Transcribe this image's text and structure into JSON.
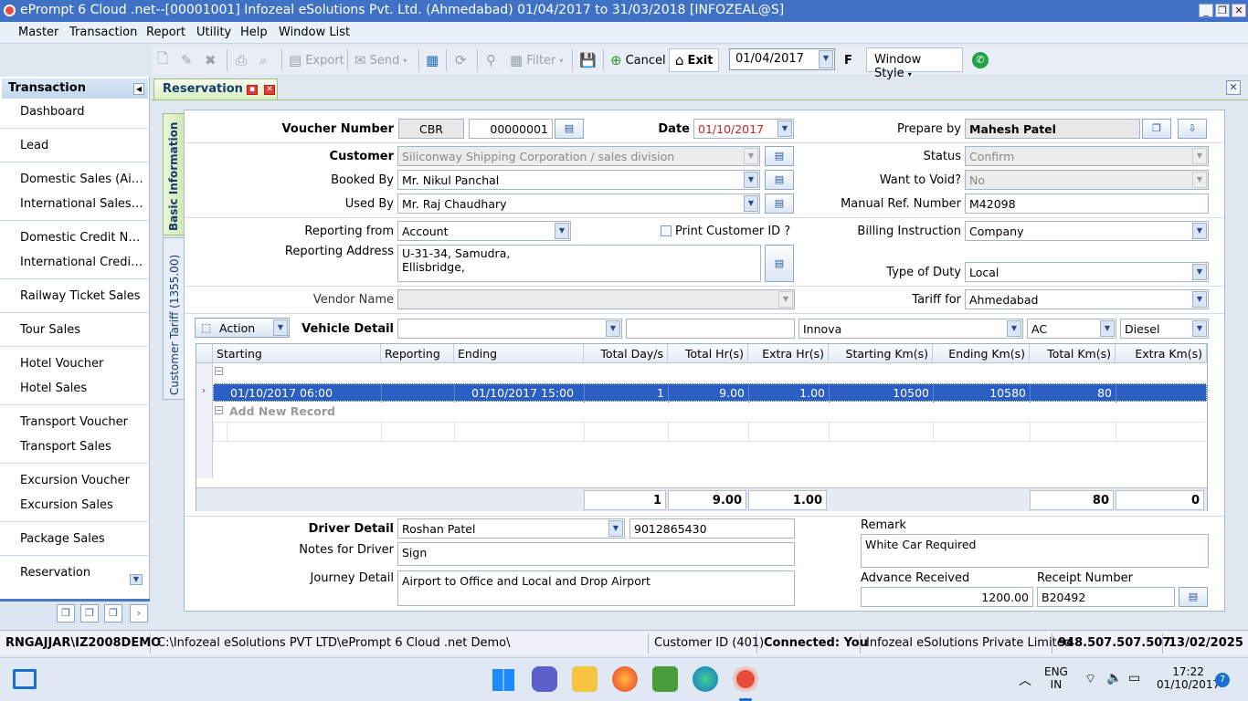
{
  "window": {
    "title": "ePrompt 6 Cloud .net--[00001001] Infozeal eSolutions Pvt. Ltd. (Ahmedabad) 01/04/2017 to 31/03/2018 [INFOZEAL@S]"
  },
  "menu": [
    "Master",
    "Transaction",
    "Report",
    "Utility",
    "Help",
    "Window List"
  ],
  "toolbar": {
    "export": "Export",
    "send": "Send",
    "filter": "Filter",
    "cancel": "Cancel",
    "exit": "Exit",
    "date": "01/04/2017",
    "f": "F",
    "window_style": "Window Style"
  },
  "sidebar": {
    "header": "Transaction",
    "items": [
      "Dashboard",
      "Lead",
      "Domestic Sales (Air ...",
      "International Sales (...",
      "Domestic Credit Note...",
      "International Credit N...",
      "Railway Ticket Sales",
      "Tour Sales",
      "Hotel Voucher",
      "Hotel Sales",
      "Transport Voucher",
      "Transport Sales",
      "Excursion Voucher",
      "Excursion Sales",
      "Package Sales",
      "Reservation"
    ]
  },
  "tab": {
    "label": "Reservation"
  },
  "vtabs": {
    "basic": "Basic Information",
    "tariff": "Customer Tariff (1355.00)"
  },
  "form": {
    "voucher_label": "Voucher Number",
    "voucher_prefix": "CBR",
    "voucher_no": "00000001",
    "date_label": "Date",
    "date": "01/10/2017",
    "prepare_label": "Prepare by",
    "prepare_by": "Mahesh Patel",
    "customer_label": "Customer",
    "customer": "Siliconway Shipping Corporation / sales division",
    "status_label": "Status",
    "status": "Confirm",
    "booked_label": "Booked By",
    "booked_by": "Mr. Nikul Panchal",
    "void_label": "Want to Void?",
    "void": "No",
    "used_label": "Used By",
    "used_by": "Mr. Raj Chaudhary",
    "manual_label": "Manual Ref. Number",
    "manual_ref": "M42098",
    "repfrom_label": "Reporting from",
    "rep_from": "Account",
    "print_cust": "Print Customer ID ?",
    "billing_label": "Billing Instruction",
    "billing": "Company",
    "repaddr_label": "Reporting Address",
    "rep_addr1": "U-31-34, Samudra,",
    "rep_addr2": "Ellisbridge,",
    "duty_label": "Type of Duty",
    "duty": "Local",
    "vendor_label": "Vendor Name",
    "vendor": "",
    "tariff_label": "Tariff for",
    "tariff": "Ahmedabad",
    "action": "Action",
    "vehicle_label": "Vehicle Detail",
    "vehicle_type": "",
    "vehicle_no": "",
    "vehicle_model": "Innova",
    "ac": "AC",
    "fuel": "Diesel"
  },
  "grid": {
    "columns": [
      "Starting",
      "Reporting",
      "Ending",
      "Total Day/s",
      "Total Hr(s)",
      "Extra Hr(s)",
      "Starting Km(s)",
      "Ending Km(s)",
      "Total Km(s)",
      "Extra Km(s)"
    ],
    "row": {
      "starting": "01/10/2017 06:00",
      "reporting": "",
      "ending": "01/10/2017 15:00",
      "days": "1",
      "hrs": "9.00",
      "extra_hrs": "1.00",
      "start_km": "10500",
      "end_km": "10580",
      "total_km": "80",
      "extra_km": ""
    },
    "add_new": "Add New Record",
    "totals": {
      "days": "1",
      "hrs": "9.00",
      "extra_hrs": "1.00",
      "total_km": "80",
      "extra_km": "0"
    }
  },
  "bottom": {
    "driver_label": "Driver Detail",
    "driver": "Roshan Patel",
    "driver_phone": "9012865430",
    "notes_label": "Notes for Driver",
    "notes": "Sign",
    "journey_label": "Journey Detail",
    "journey": "Airport to Office and Local and Drop Airport",
    "remark_label": "Remark",
    "remark": "White Car Required",
    "advance_label": "Advance Received",
    "advance": "1200.00",
    "receipt_label": "Receipt Number",
    "receipt": "B20492"
  },
  "status": {
    "user": "RNGAJJAR\\IZ2008DEMO",
    "path": "C:\\Infozeal eSolutions PVT LTD\\ePrompt 6 Cloud .net Demo\\",
    "customer_id": "Customer ID (401)",
    "connected": "Connected: You",
    "company": "Infozeal eSolutions Private Limited",
    "phone": "948.507.507.507",
    "date": "13/02/2025"
  },
  "taskbar": {
    "lang1": "ENG",
    "lang2": "IN",
    "time": "17:22",
    "date": "01/10/2017",
    "badge": "7"
  },
  "colors": {
    "title": "#3f71c4",
    "selection": "#2c5fc4",
    "accent_red": "#c22"
  }
}
